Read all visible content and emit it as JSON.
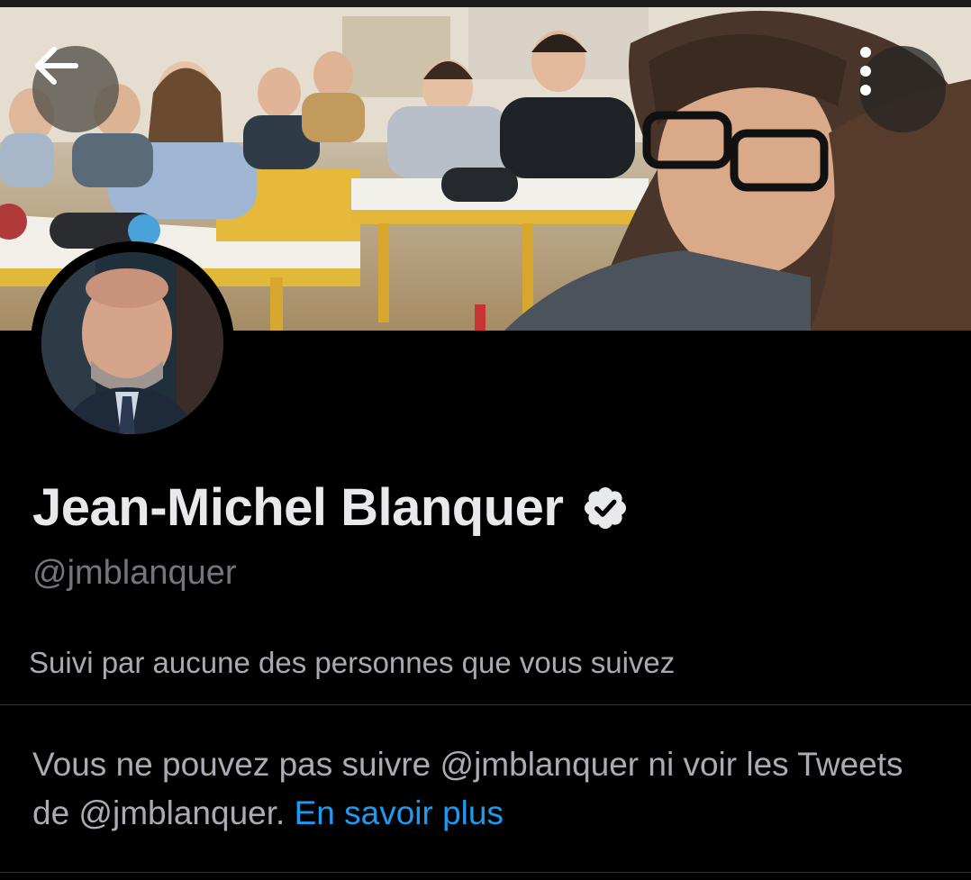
{
  "header": {
    "back_icon": "arrow-left-icon",
    "more_icon": "more-vertical-icon"
  },
  "profile": {
    "name": "Jean-Michel Blanquer",
    "verified_icon": "verified-badge-icon",
    "handle": "@jmblanquer",
    "followed_by": "Suivi par aucune des personnes que vous suivez"
  },
  "notice": {
    "text": "Vous ne pouvez pas suivre @jmblanquer ni voir les Tweets de @jmblanquer.",
    "link_label": "En savoir plus"
  },
  "colors": {
    "background": "#000000",
    "text_primary": "#e7e9ea",
    "text_secondary": "#71767b",
    "link": "#1d9bf0"
  }
}
